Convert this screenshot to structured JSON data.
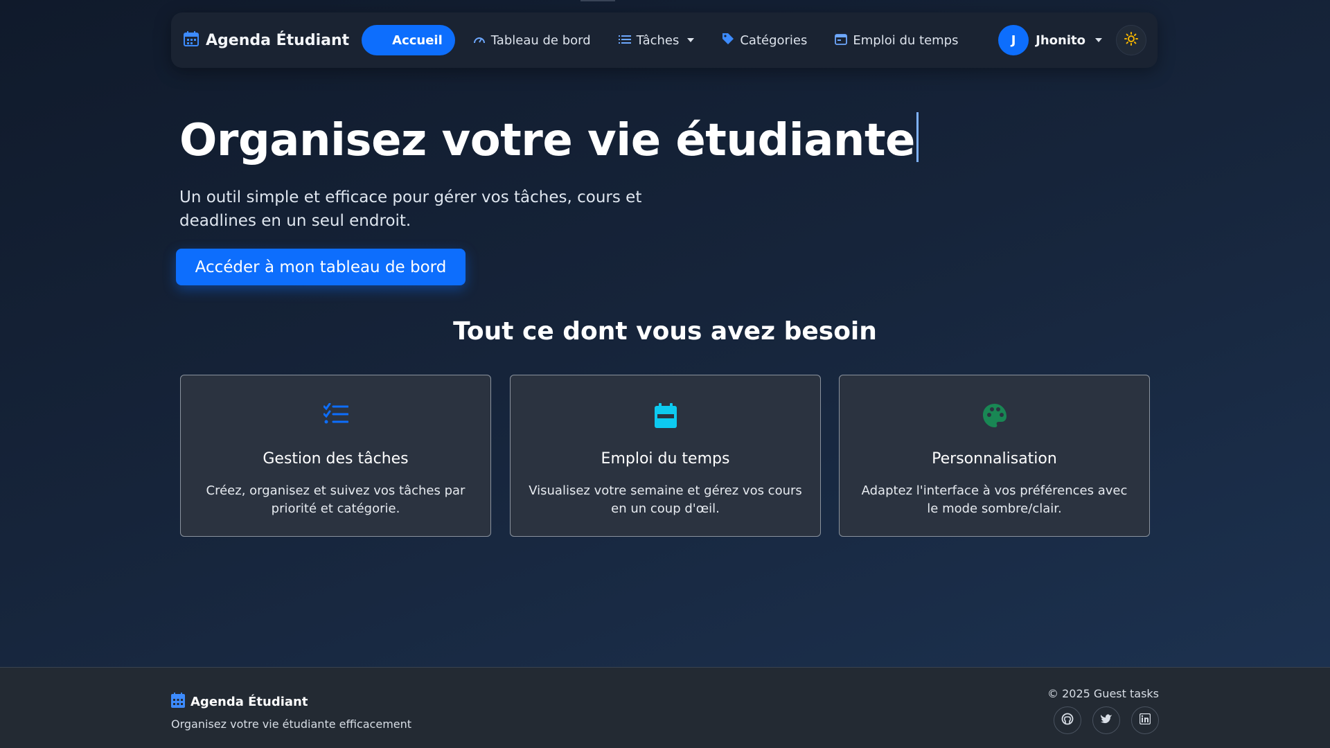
{
  "nav": {
    "brand": "Agenda Étudiant",
    "items": [
      {
        "label": "Accueil",
        "icon": "home-icon"
      },
      {
        "label": "Tableau de bord",
        "icon": "gauge-icon"
      },
      {
        "label": "Tâches",
        "icon": "list-icon"
      },
      {
        "label": "Catégories",
        "icon": "tag-icon"
      },
      {
        "label": "Emploi du temps",
        "icon": "calendar-icon"
      }
    ],
    "user": {
      "initial": "J",
      "name": "Jhonito"
    },
    "theme_icon": "sun-icon"
  },
  "hero": {
    "title": "Organisez votre vie étudiante",
    "subtitle": "Un outil simple et efficace pour gérer vos tâches, cours et deadlines en un seul endroit.",
    "cta": "Accéder à mon tableau de bord"
  },
  "features": {
    "title": "Tout ce dont vous avez besoin",
    "cards": [
      {
        "title": "Gestion des tâches",
        "desc": "Créez, organisez et suivez vos tâches par priorité et catégorie.",
        "icon": "checklist-icon",
        "color": "#0d6efd"
      },
      {
        "title": "Emploi du temps",
        "desc": "Visualisez votre semaine et gérez vos cours en un coup d'œil.",
        "icon": "calendar-icon",
        "color": "#0dcaf0"
      },
      {
        "title": "Personnalisation",
        "desc": "Adaptez l'interface à vos préférences avec le mode sombre/clair.",
        "icon": "palette-icon",
        "color": "#198754"
      }
    ]
  },
  "footer": {
    "brand": "Agenda Étudiant",
    "tagline": "Organisez votre vie étudiante efficacement",
    "copyright": "© 2025 Guest tasks",
    "socials": [
      "github-icon",
      "twitter-icon",
      "linkedin-icon"
    ]
  },
  "colors": {
    "accent": "#0d6efd",
    "info": "#0dcaf0",
    "success": "#198754",
    "sun": "#f4b400"
  }
}
